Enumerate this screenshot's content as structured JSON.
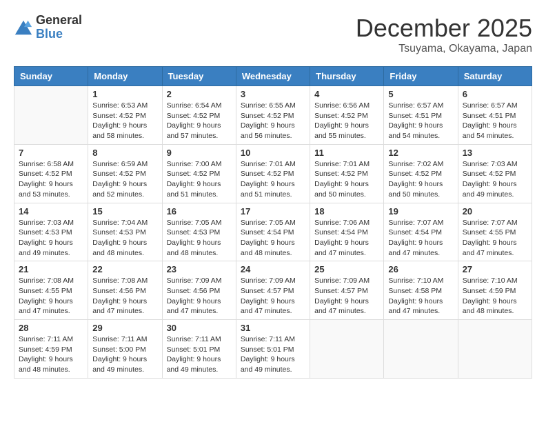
{
  "logo": {
    "general": "General",
    "blue": "Blue"
  },
  "title": "December 2025",
  "location": "Tsuyama, Okayama, Japan",
  "days_of_week": [
    "Sunday",
    "Monday",
    "Tuesday",
    "Wednesday",
    "Thursday",
    "Friday",
    "Saturday"
  ],
  "weeks": [
    [
      {
        "day": "",
        "info": ""
      },
      {
        "day": "1",
        "info": "Sunrise: 6:53 AM\nSunset: 4:52 PM\nDaylight: 9 hours\nand 58 minutes."
      },
      {
        "day": "2",
        "info": "Sunrise: 6:54 AM\nSunset: 4:52 PM\nDaylight: 9 hours\nand 57 minutes."
      },
      {
        "day": "3",
        "info": "Sunrise: 6:55 AM\nSunset: 4:52 PM\nDaylight: 9 hours\nand 56 minutes."
      },
      {
        "day": "4",
        "info": "Sunrise: 6:56 AM\nSunset: 4:52 PM\nDaylight: 9 hours\nand 55 minutes."
      },
      {
        "day": "5",
        "info": "Sunrise: 6:57 AM\nSunset: 4:51 PM\nDaylight: 9 hours\nand 54 minutes."
      },
      {
        "day": "6",
        "info": "Sunrise: 6:57 AM\nSunset: 4:51 PM\nDaylight: 9 hours\nand 54 minutes."
      }
    ],
    [
      {
        "day": "7",
        "info": "Sunrise: 6:58 AM\nSunset: 4:52 PM\nDaylight: 9 hours\nand 53 minutes."
      },
      {
        "day": "8",
        "info": "Sunrise: 6:59 AM\nSunset: 4:52 PM\nDaylight: 9 hours\nand 52 minutes."
      },
      {
        "day": "9",
        "info": "Sunrise: 7:00 AM\nSunset: 4:52 PM\nDaylight: 9 hours\nand 51 minutes."
      },
      {
        "day": "10",
        "info": "Sunrise: 7:01 AM\nSunset: 4:52 PM\nDaylight: 9 hours\nand 51 minutes."
      },
      {
        "day": "11",
        "info": "Sunrise: 7:01 AM\nSunset: 4:52 PM\nDaylight: 9 hours\nand 50 minutes."
      },
      {
        "day": "12",
        "info": "Sunrise: 7:02 AM\nSunset: 4:52 PM\nDaylight: 9 hours\nand 50 minutes."
      },
      {
        "day": "13",
        "info": "Sunrise: 7:03 AM\nSunset: 4:52 PM\nDaylight: 9 hours\nand 49 minutes."
      }
    ],
    [
      {
        "day": "14",
        "info": "Sunrise: 7:03 AM\nSunset: 4:53 PM\nDaylight: 9 hours\nand 49 minutes."
      },
      {
        "day": "15",
        "info": "Sunrise: 7:04 AM\nSunset: 4:53 PM\nDaylight: 9 hours\nand 48 minutes."
      },
      {
        "day": "16",
        "info": "Sunrise: 7:05 AM\nSunset: 4:53 PM\nDaylight: 9 hours\nand 48 minutes."
      },
      {
        "day": "17",
        "info": "Sunrise: 7:05 AM\nSunset: 4:54 PM\nDaylight: 9 hours\nand 48 minutes."
      },
      {
        "day": "18",
        "info": "Sunrise: 7:06 AM\nSunset: 4:54 PM\nDaylight: 9 hours\nand 47 minutes."
      },
      {
        "day": "19",
        "info": "Sunrise: 7:07 AM\nSunset: 4:54 PM\nDaylight: 9 hours\nand 47 minutes."
      },
      {
        "day": "20",
        "info": "Sunrise: 7:07 AM\nSunset: 4:55 PM\nDaylight: 9 hours\nand 47 minutes."
      }
    ],
    [
      {
        "day": "21",
        "info": "Sunrise: 7:08 AM\nSunset: 4:55 PM\nDaylight: 9 hours\nand 47 minutes."
      },
      {
        "day": "22",
        "info": "Sunrise: 7:08 AM\nSunset: 4:56 PM\nDaylight: 9 hours\nand 47 minutes."
      },
      {
        "day": "23",
        "info": "Sunrise: 7:09 AM\nSunset: 4:56 PM\nDaylight: 9 hours\nand 47 minutes."
      },
      {
        "day": "24",
        "info": "Sunrise: 7:09 AM\nSunset: 4:57 PM\nDaylight: 9 hours\nand 47 minutes."
      },
      {
        "day": "25",
        "info": "Sunrise: 7:09 AM\nSunset: 4:57 PM\nDaylight: 9 hours\nand 47 minutes."
      },
      {
        "day": "26",
        "info": "Sunrise: 7:10 AM\nSunset: 4:58 PM\nDaylight: 9 hours\nand 47 minutes."
      },
      {
        "day": "27",
        "info": "Sunrise: 7:10 AM\nSunset: 4:59 PM\nDaylight: 9 hours\nand 48 minutes."
      }
    ],
    [
      {
        "day": "28",
        "info": "Sunrise: 7:11 AM\nSunset: 4:59 PM\nDaylight: 9 hours\nand 48 minutes."
      },
      {
        "day": "29",
        "info": "Sunrise: 7:11 AM\nSunset: 5:00 PM\nDaylight: 9 hours\nand 49 minutes."
      },
      {
        "day": "30",
        "info": "Sunrise: 7:11 AM\nSunset: 5:01 PM\nDaylight: 9 hours\nand 49 minutes."
      },
      {
        "day": "31",
        "info": "Sunrise: 7:11 AM\nSunset: 5:01 PM\nDaylight: 9 hours\nand 49 minutes."
      },
      {
        "day": "",
        "info": ""
      },
      {
        "day": "",
        "info": ""
      },
      {
        "day": "",
        "info": ""
      }
    ]
  ]
}
